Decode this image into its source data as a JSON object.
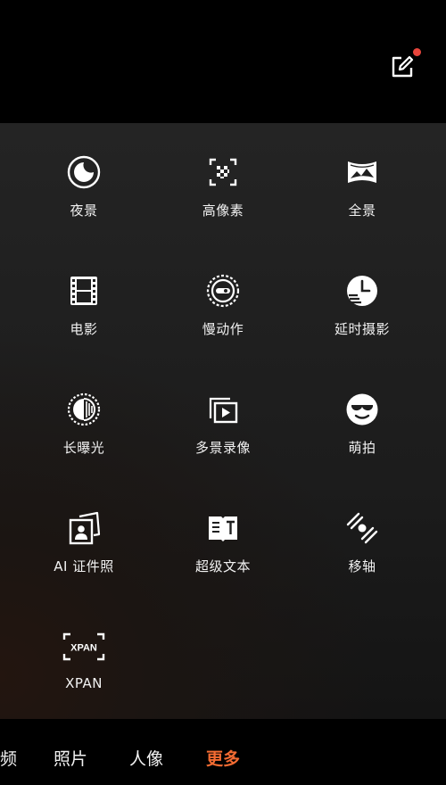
{
  "top_bar": {
    "edit_icon": "edit-icon",
    "has_notification": true,
    "notification_color": "#e8453c"
  },
  "modes": [
    {
      "label": "夜景",
      "icon": "night-mode-icon"
    },
    {
      "label": "高像素",
      "icon": "high-pixel-icon"
    },
    {
      "label": "全景",
      "icon": "panorama-icon"
    },
    {
      "label": "电影",
      "icon": "film-icon"
    },
    {
      "label": "慢动作",
      "icon": "slow-motion-icon"
    },
    {
      "label": "延时摄影",
      "icon": "time-lapse-icon"
    },
    {
      "label": "长曝光",
      "icon": "long-exposure-icon"
    },
    {
      "label": "多景录像",
      "icon": "multi-scene-video-icon"
    },
    {
      "label": "萌拍",
      "icon": "cute-shot-icon"
    },
    {
      "label": "AI 证件照",
      "icon": "ai-id-photo-icon"
    },
    {
      "label": "超级文本",
      "icon": "super-text-icon"
    },
    {
      "label": "移轴",
      "icon": "tilt-shift-icon"
    },
    {
      "label": "XPAN",
      "icon": "xpan-icon",
      "icon_text": "XPAN"
    }
  ],
  "tabs": [
    {
      "label": "频"
    },
    {
      "label": "照片"
    },
    {
      "label": "人像"
    },
    {
      "label": "更多",
      "active": true
    }
  ],
  "colors": {
    "accent": "#f36b32",
    "text": "#f2f2f2",
    "background": "#000000"
  }
}
